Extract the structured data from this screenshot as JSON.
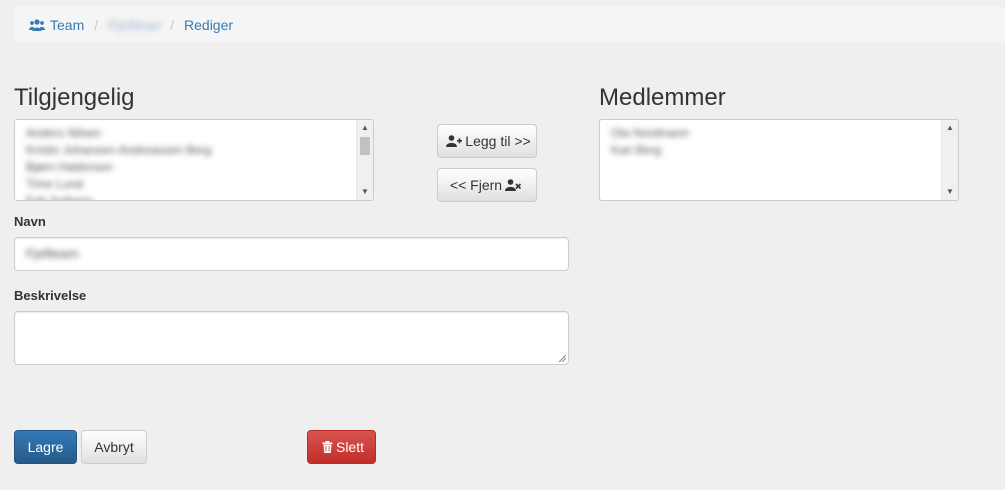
{
  "breadcrumb": {
    "team": "Team",
    "current_team": "Fjellteam",
    "edit": "Rediger",
    "separator": "/"
  },
  "available": {
    "title": "Tilgjengelig",
    "items": [
      "Anders Nilsen",
      "Kristin Johansen-Andreassen Berg",
      "Bjørn Haldorsen",
      "Trine Lund",
      "Erik Solheim"
    ]
  },
  "members": {
    "title": "Medlemmer",
    "items": [
      "Ola Nordmann",
      "Kari Berg"
    ]
  },
  "actions": {
    "add_label": "Legg til >>",
    "remove_label": "<< Fjern"
  },
  "form": {
    "name_label": "Navn",
    "name_value": "Fjellteam",
    "description_label": "Beskrivelse",
    "description_value": ""
  },
  "footer": {
    "save_label": "Lagre",
    "cancel_label": "Avbryt",
    "delete_label": "Slett"
  },
  "colors": {
    "link": "#337ab7",
    "primary": "#337ab7",
    "danger": "#d9534f",
    "background": "#efefef"
  },
  "icons": {
    "team": "users-icon",
    "add": "user-plus-icon",
    "remove": "user-times-icon",
    "delete": "trash-icon"
  }
}
